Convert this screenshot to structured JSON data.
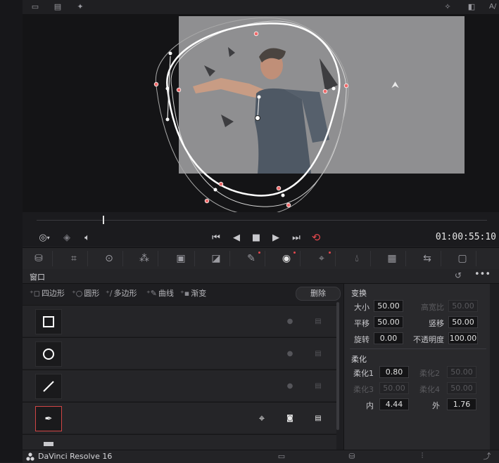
{
  "app": {
    "name": "DaVinci Resolve 16"
  },
  "top_bar": {
    "right_label": "A/"
  },
  "transport": {
    "timecode": "01:00:55:10"
  },
  "window_panel": {
    "title": "窗口",
    "shapes": [
      "四边形",
      "圆形",
      "多边形",
      "曲线",
      "渐变"
    ],
    "delete_label": "删除"
  },
  "transform": {
    "title": "变换",
    "size_label": "大小",
    "size_value": "50.00",
    "aspect_label": "高宽比",
    "aspect_value": "50.00",
    "pan_label": "平移",
    "pan_value": "50.00",
    "tilt_label": "竖移",
    "tilt_value": "50.00",
    "rotate_label": "旋转",
    "rotate_value": "0.00",
    "opacity_label": "不透明度",
    "opacity_value": "100.00"
  },
  "softness": {
    "title": "柔化",
    "soft1_label": "柔化1",
    "soft1_value": "0.80",
    "soft2_label": "柔化2",
    "soft2_value": "50.00",
    "soft3_label": "柔化3",
    "soft3_value": "50.00",
    "soft4_label": "柔化4",
    "soft4_value": "50.00",
    "inside_label": "内",
    "inside_value": "4.44",
    "outside_label": "外",
    "outside_value": "1.76"
  },
  "colors": {
    "accent": "#e5484d",
    "panel": "#29292c",
    "background": "#1e1e21"
  }
}
